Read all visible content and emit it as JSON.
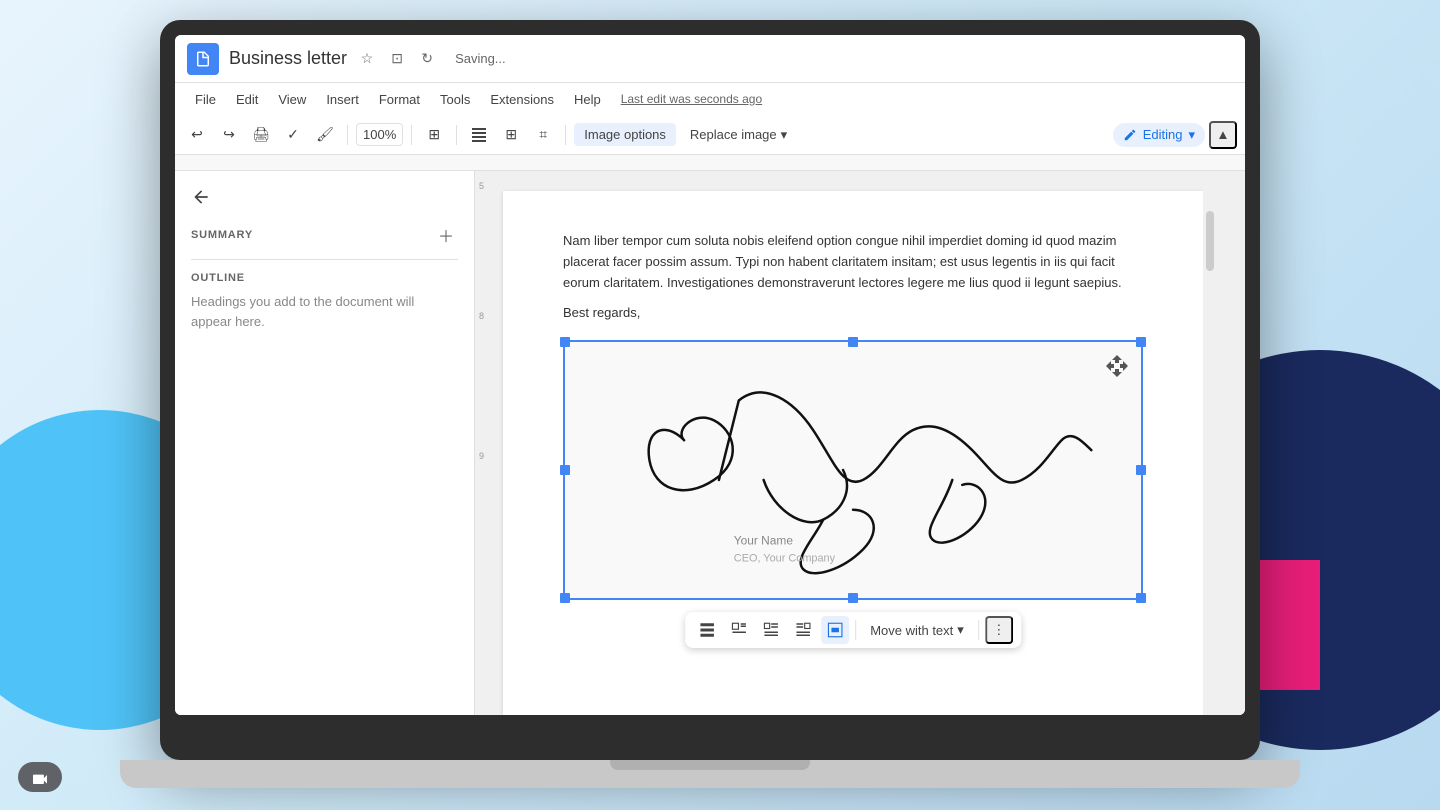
{
  "app": {
    "title": "Business letter",
    "saving_status": "Saving...",
    "last_edit": "Last edit was seconds ago"
  },
  "menu": {
    "file": "File",
    "edit": "Edit",
    "view": "View",
    "insert": "Insert",
    "format": "Format",
    "tools": "Tools",
    "extensions": "Extensions",
    "help": "Help"
  },
  "toolbar": {
    "zoom": "100%",
    "image_options": "Image options",
    "replace_image": "Replace image",
    "editing": "Editing"
  },
  "sidebar": {
    "summary_label": "SUMMARY",
    "outline_label": "OUTLINE",
    "outline_hint": "Headings you add to the document will appear here."
  },
  "document": {
    "paragraph": "Nam liber tempor cum soluta nobis eleifend option congue nihil imperdiet doming id quod mazim placerat facer possim assum. Typi non habent claritatem insitam; est usus legentis in iis qui facit eorum claritatem. Investigationes demonstraverunt lectores legere me lius quod ii legunt saepius.",
    "regards": "Best regards,",
    "signature_name": "Your Name",
    "signature_title": "CEO, Your Company"
  },
  "float_toolbar": {
    "move_with_text": "Move with text",
    "wrap_options": [
      "inline",
      "wrap-square",
      "wrap-left",
      "wrap-right",
      "wrap-none"
    ]
  }
}
